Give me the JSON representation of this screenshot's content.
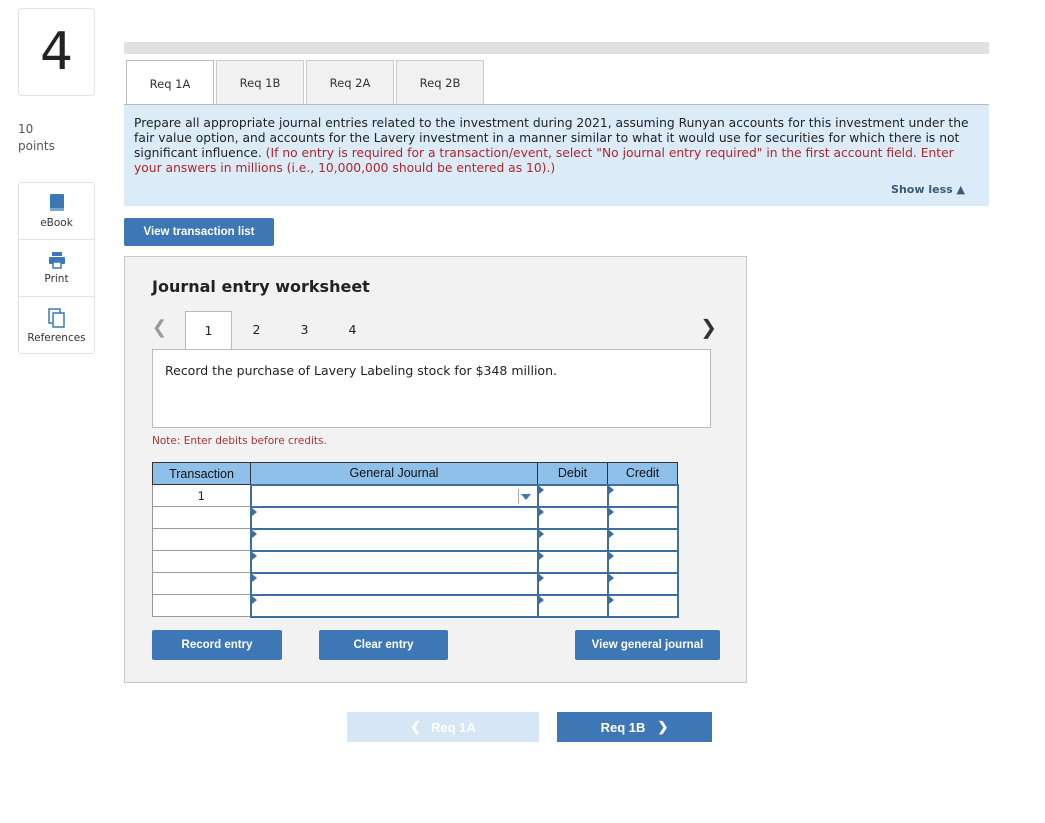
{
  "question": {
    "number": "4",
    "points_value": "10",
    "points_label": "points"
  },
  "tools": [
    {
      "label": "eBook",
      "icon": "book-icon"
    },
    {
      "label": "Print",
      "icon": "printer-icon"
    },
    {
      "label": "References",
      "icon": "documents-icon"
    }
  ],
  "tabs": [
    {
      "label": "Req 1A",
      "active": true
    },
    {
      "label": "Req 1B",
      "active": false
    },
    {
      "label": "Req 2A",
      "active": false
    },
    {
      "label": "Req 2B",
      "active": false
    }
  ],
  "instructions": {
    "main": "Prepare all appropriate journal entries related to the investment during 2021, assuming Runyan accounts for this investment under the fair value option, and accounts for the Lavery investment in a manner similar to what it would use for securities for which there is not significant influence.",
    "highlight": "(If no entry is required for a transaction/event, select \"No journal entry required\" in the first account field. Enter your answers in millions (i.e., 10,000,000 should be entered as 10).)",
    "show_less": "Show less"
  },
  "view_transaction_list": "View transaction list",
  "worksheet": {
    "title": "Journal entry worksheet",
    "pages": [
      "1",
      "2",
      "3",
      "4"
    ],
    "active_page": "1",
    "description": "Record the purchase of Lavery Labeling stock for $348 million.",
    "note": "Note: Enter debits before credits.",
    "columns": [
      "Transaction",
      "General Journal",
      "Debit",
      "Credit"
    ],
    "rows": [
      {
        "transaction": "1",
        "account": "",
        "debit": "",
        "credit": ""
      },
      {
        "transaction": "",
        "account": "",
        "debit": "",
        "credit": ""
      },
      {
        "transaction": "",
        "account": "",
        "debit": "",
        "credit": ""
      },
      {
        "transaction": "",
        "account": "",
        "debit": "",
        "credit": ""
      },
      {
        "transaction": "",
        "account": "",
        "debit": "",
        "credit": ""
      },
      {
        "transaction": "",
        "account": "",
        "debit": "",
        "credit": ""
      }
    ],
    "record_entry": "Record entry",
    "clear_entry": "Clear entry",
    "view_general_journal": "View general journal"
  },
  "nav": {
    "prev_label": "Req 1A",
    "next_label": "Req 1B"
  },
  "colors": {
    "primary": "#3d77b6",
    "header_blue": "#8fc0ea",
    "instr_bg": "#dbecf8",
    "red_text": "#b0262a"
  }
}
